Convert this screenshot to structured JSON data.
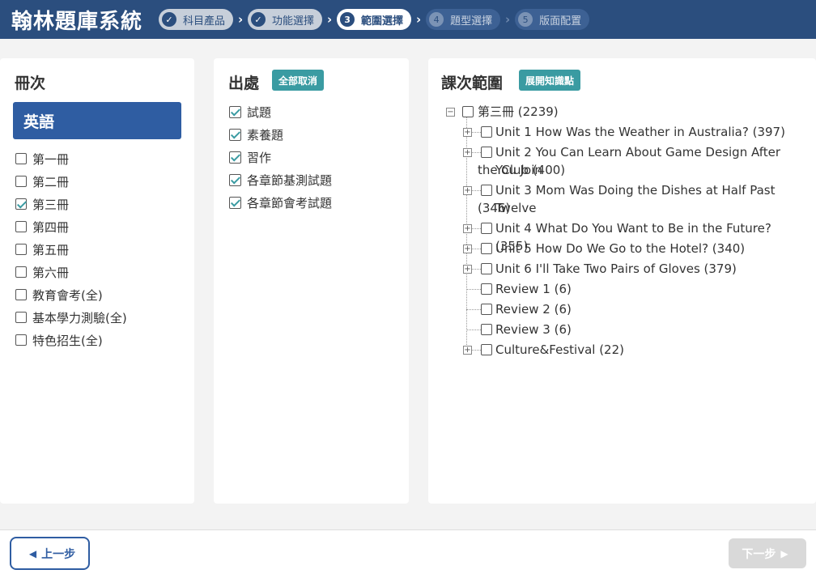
{
  "header": {
    "app_title": "翰林題庫系統",
    "steps": [
      {
        "num": "✓",
        "label": "科目產品",
        "state": "done"
      },
      {
        "num": "✓",
        "label": "功能選擇",
        "state": "done"
      },
      {
        "num": "3",
        "label": "範圍選擇",
        "state": "current"
      },
      {
        "num": "4",
        "label": "題型選擇",
        "state": "future"
      },
      {
        "num": "5",
        "label": "版面配置",
        "state": "future"
      }
    ],
    "sep_glyph": "›"
  },
  "volumes": {
    "title": "冊次",
    "subject": "英語",
    "items": [
      {
        "label": "第一冊",
        "checked": false
      },
      {
        "label": "第二冊",
        "checked": false
      },
      {
        "label": "第三冊",
        "checked": true
      },
      {
        "label": "第四冊",
        "checked": false
      },
      {
        "label": "第五冊",
        "checked": false
      },
      {
        "label": "第六冊",
        "checked": false
      },
      {
        "label": "教育會考(全)",
        "checked": false
      },
      {
        "label": "基本學力測驗(全)",
        "checked": false
      },
      {
        "label": "特色招生(全)",
        "checked": false
      }
    ]
  },
  "sources": {
    "title": "出處",
    "cancel_all_label": "全部取消",
    "items": [
      {
        "label": "試題",
        "checked": true
      },
      {
        "label": "素養題",
        "checked": true
      },
      {
        "label": "習作",
        "checked": true
      },
      {
        "label": "各章節基測試題",
        "checked": true
      },
      {
        "label": "各章節會考試題",
        "checked": true
      }
    ]
  },
  "lessons": {
    "title": "課次範圍",
    "expand_label": "展開知識點",
    "root": {
      "label": "第三冊 (2239)",
      "toggle": "−"
    },
    "children": [
      {
        "label_l1": "Unit 1 How Was the Weather in Australia? (397)",
        "label_l2": "",
        "toggle": "+"
      },
      {
        "label_l1": "Unit 2 You Can Learn About Game Design After You Join",
        "label_l2": "the Club (400)",
        "toggle": "+"
      },
      {
        "label_l1": "Unit 3 Mom Was Doing the Dishes at Half Past Twelve",
        "label_l2": "(346)",
        "toggle": "+"
      },
      {
        "label_l1": "Unit 4 What Do You Want to Be in the Future? (355)",
        "label_l2": "",
        "toggle": "+"
      },
      {
        "label_l1": "Unit 5 How Do We Go to the Hotel? (340)",
        "label_l2": "",
        "toggle": "+"
      },
      {
        "label_l1": "Unit 6 I'll Take Two Pairs of Gloves (379)",
        "label_l2": "",
        "toggle": "+"
      },
      {
        "label_l1": "Review 1 (6)",
        "label_l2": "",
        "toggle": ""
      },
      {
        "label_l1": "Review 2 (6)",
        "label_l2": "",
        "toggle": ""
      },
      {
        "label_l1": "Review 3 (6)",
        "label_l2": "",
        "toggle": ""
      },
      {
        "label_l1": "Culture&Festival (22)",
        "label_l2": "",
        "toggle": "+"
      }
    ]
  },
  "footer": {
    "prev_label": "上一步",
    "prev_arrow": "◀",
    "next_label": "下一步",
    "next_arrow": "▶"
  },
  "colors": {
    "header_bg": "#2b4e7e",
    "subject_bg": "#2f5da2",
    "accent_teal": "#3a9ba2",
    "disabled": "#d9d9d9"
  }
}
